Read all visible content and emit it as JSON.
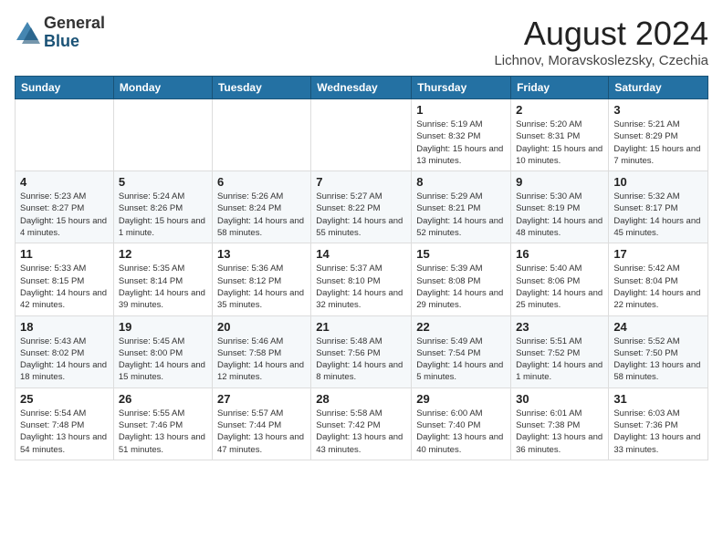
{
  "header": {
    "logo_general": "General",
    "logo_blue": "Blue",
    "month_year": "August 2024",
    "location": "Lichnov, Moravskoslezsky, Czechia"
  },
  "weekdays": [
    "Sunday",
    "Monday",
    "Tuesday",
    "Wednesday",
    "Thursday",
    "Friday",
    "Saturday"
  ],
  "weeks": [
    [
      {
        "day": "",
        "detail": ""
      },
      {
        "day": "",
        "detail": ""
      },
      {
        "day": "",
        "detail": ""
      },
      {
        "day": "",
        "detail": ""
      },
      {
        "day": "1",
        "detail": "Sunrise: 5:19 AM\nSunset: 8:32 PM\nDaylight: 15 hours\nand 13 minutes."
      },
      {
        "day": "2",
        "detail": "Sunrise: 5:20 AM\nSunset: 8:31 PM\nDaylight: 15 hours\nand 10 minutes."
      },
      {
        "day": "3",
        "detail": "Sunrise: 5:21 AM\nSunset: 8:29 PM\nDaylight: 15 hours\nand 7 minutes."
      }
    ],
    [
      {
        "day": "4",
        "detail": "Sunrise: 5:23 AM\nSunset: 8:27 PM\nDaylight: 15 hours\nand 4 minutes."
      },
      {
        "day": "5",
        "detail": "Sunrise: 5:24 AM\nSunset: 8:26 PM\nDaylight: 15 hours\nand 1 minute."
      },
      {
        "day": "6",
        "detail": "Sunrise: 5:26 AM\nSunset: 8:24 PM\nDaylight: 14 hours\nand 58 minutes."
      },
      {
        "day": "7",
        "detail": "Sunrise: 5:27 AM\nSunset: 8:22 PM\nDaylight: 14 hours\nand 55 minutes."
      },
      {
        "day": "8",
        "detail": "Sunrise: 5:29 AM\nSunset: 8:21 PM\nDaylight: 14 hours\nand 52 minutes."
      },
      {
        "day": "9",
        "detail": "Sunrise: 5:30 AM\nSunset: 8:19 PM\nDaylight: 14 hours\nand 48 minutes."
      },
      {
        "day": "10",
        "detail": "Sunrise: 5:32 AM\nSunset: 8:17 PM\nDaylight: 14 hours\nand 45 minutes."
      }
    ],
    [
      {
        "day": "11",
        "detail": "Sunrise: 5:33 AM\nSunset: 8:15 PM\nDaylight: 14 hours\nand 42 minutes."
      },
      {
        "day": "12",
        "detail": "Sunrise: 5:35 AM\nSunset: 8:14 PM\nDaylight: 14 hours\nand 39 minutes."
      },
      {
        "day": "13",
        "detail": "Sunrise: 5:36 AM\nSunset: 8:12 PM\nDaylight: 14 hours\nand 35 minutes."
      },
      {
        "day": "14",
        "detail": "Sunrise: 5:37 AM\nSunset: 8:10 PM\nDaylight: 14 hours\nand 32 minutes."
      },
      {
        "day": "15",
        "detail": "Sunrise: 5:39 AM\nSunset: 8:08 PM\nDaylight: 14 hours\nand 29 minutes."
      },
      {
        "day": "16",
        "detail": "Sunrise: 5:40 AM\nSunset: 8:06 PM\nDaylight: 14 hours\nand 25 minutes."
      },
      {
        "day": "17",
        "detail": "Sunrise: 5:42 AM\nSunset: 8:04 PM\nDaylight: 14 hours\nand 22 minutes."
      }
    ],
    [
      {
        "day": "18",
        "detail": "Sunrise: 5:43 AM\nSunset: 8:02 PM\nDaylight: 14 hours\nand 18 minutes."
      },
      {
        "day": "19",
        "detail": "Sunrise: 5:45 AM\nSunset: 8:00 PM\nDaylight: 14 hours\nand 15 minutes."
      },
      {
        "day": "20",
        "detail": "Sunrise: 5:46 AM\nSunset: 7:58 PM\nDaylight: 14 hours\nand 12 minutes."
      },
      {
        "day": "21",
        "detail": "Sunrise: 5:48 AM\nSunset: 7:56 PM\nDaylight: 14 hours\nand 8 minutes."
      },
      {
        "day": "22",
        "detail": "Sunrise: 5:49 AM\nSunset: 7:54 PM\nDaylight: 14 hours\nand 5 minutes."
      },
      {
        "day": "23",
        "detail": "Sunrise: 5:51 AM\nSunset: 7:52 PM\nDaylight: 14 hours\nand 1 minute."
      },
      {
        "day": "24",
        "detail": "Sunrise: 5:52 AM\nSunset: 7:50 PM\nDaylight: 13 hours\nand 58 minutes."
      }
    ],
    [
      {
        "day": "25",
        "detail": "Sunrise: 5:54 AM\nSunset: 7:48 PM\nDaylight: 13 hours\nand 54 minutes."
      },
      {
        "day": "26",
        "detail": "Sunrise: 5:55 AM\nSunset: 7:46 PM\nDaylight: 13 hours\nand 51 minutes."
      },
      {
        "day": "27",
        "detail": "Sunrise: 5:57 AM\nSunset: 7:44 PM\nDaylight: 13 hours\nand 47 minutes."
      },
      {
        "day": "28",
        "detail": "Sunrise: 5:58 AM\nSunset: 7:42 PM\nDaylight: 13 hours\nand 43 minutes."
      },
      {
        "day": "29",
        "detail": "Sunrise: 6:00 AM\nSunset: 7:40 PM\nDaylight: 13 hours\nand 40 minutes."
      },
      {
        "day": "30",
        "detail": "Sunrise: 6:01 AM\nSunset: 7:38 PM\nDaylight: 13 hours\nand 36 minutes."
      },
      {
        "day": "31",
        "detail": "Sunrise: 6:03 AM\nSunset: 7:36 PM\nDaylight: 13 hours\nand 33 minutes."
      }
    ]
  ]
}
